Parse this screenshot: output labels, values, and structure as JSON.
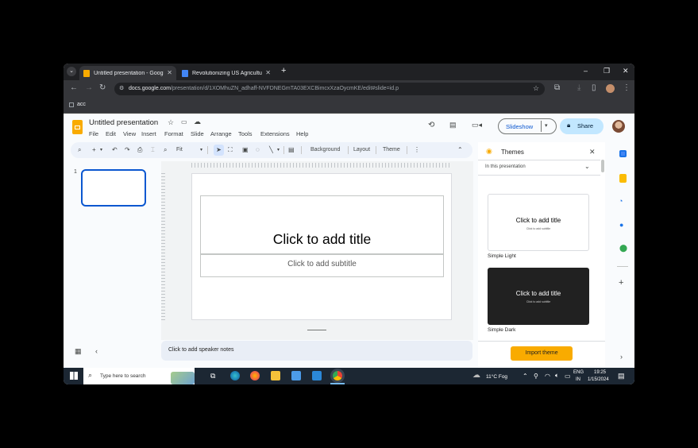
{
  "browser": {
    "tabs": [
      {
        "title": "Untitled presentation - Google",
        "active": true,
        "icon_color": "#f9ab00"
      },
      {
        "title": "Revolutionizing US Agricultural",
        "active": false,
        "icon_color": "#4285f4"
      }
    ],
    "url_host": "docs.google.com",
    "url_path": "/presentation/d/1XOMhuZN_adhaff-NVFDNEGmTA03EXCBimcxXzaOycmKE/edit#slide=id.p",
    "bookmark": "acc"
  },
  "doc": {
    "title": "Untitled presentation",
    "menu": [
      "File",
      "Edit",
      "View",
      "Insert",
      "Format",
      "Slide",
      "Arrange",
      "Tools",
      "Extensions",
      "Help"
    ],
    "slideshow_label": "Slideshow",
    "share_label": "Share"
  },
  "toolbar": {
    "zoom": "Fit",
    "background": "Background",
    "layout": "Layout",
    "theme": "Theme"
  },
  "filmstrip": {
    "slide_number": "1"
  },
  "slide": {
    "title_placeholder": "Click to add title",
    "subtitle_placeholder": "Click to add subtitle"
  },
  "notes": {
    "placeholder": "Click to add speaker notes"
  },
  "themes_panel": {
    "title": "Themes",
    "filter": "In this presentation",
    "themes": [
      {
        "name": "Simple Light",
        "title": "Click to add title",
        "subtitle": "Click to add subtitle",
        "bg": "#ffffff",
        "fg": "#000000"
      },
      {
        "name": "Simple Dark",
        "title": "Click to add title",
        "subtitle": "Click to add subtitle",
        "bg": "#212121",
        "fg": "#ffffff"
      }
    ],
    "import_label": "Import theme",
    "import_color": "#f9ab00"
  },
  "taskbar": {
    "search_placeholder": "Type here to search",
    "weather": "11°C  Fog",
    "lang_top": "ENG",
    "lang_bottom": "IN",
    "time": "19:25",
    "date": "1/15/2024"
  }
}
